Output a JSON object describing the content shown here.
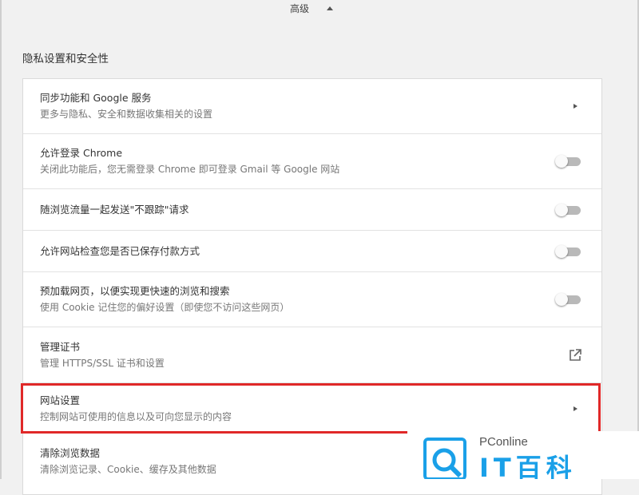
{
  "advanced": {
    "label": "高级"
  },
  "section": {
    "title": "隐私设置和安全性"
  },
  "rows": [
    {
      "primary": "同步功能和 Google 服务",
      "secondary": "更多与隐私、安全和数据收集相关的设置",
      "control": "arrow"
    },
    {
      "primary": "允许登录 Chrome",
      "secondary": "关闭此功能后，您无需登录 Chrome 即可登录 Gmail 等 Google 网站",
      "control": "toggle",
      "state": "off"
    },
    {
      "primary": "随浏览流量一起发送\"不跟踪\"请求",
      "control": "toggle",
      "state": "off"
    },
    {
      "primary": "允许网站检查您是否已保存付款方式",
      "control": "toggle",
      "state": "off"
    },
    {
      "primary": "预加载网页，以便实现更快速的浏览和搜索",
      "secondary": "使用 Cookie 记住您的偏好设置（即使您不访问这些网页）",
      "control": "toggle",
      "state": "off"
    },
    {
      "primary": "管理证书",
      "secondary": "管理 HTTPS/SSL 证书和设置",
      "control": "external-link"
    },
    {
      "primary": "网站设置",
      "secondary": "控制网站可使用的信息以及可向您显示的内容",
      "control": "arrow",
      "highlighted": true
    },
    {
      "primary": "清除浏览数据",
      "secondary": "清除浏览记录、Cookie、缓存及其他数据"
    }
  ],
  "watermark": {
    "brand": "PConline",
    "site": "IT百科"
  },
  "colors": {
    "highlight": "#e02828",
    "toggle_off_track": "#b9b9b9",
    "watermark_blue": "#1aa0e8"
  }
}
